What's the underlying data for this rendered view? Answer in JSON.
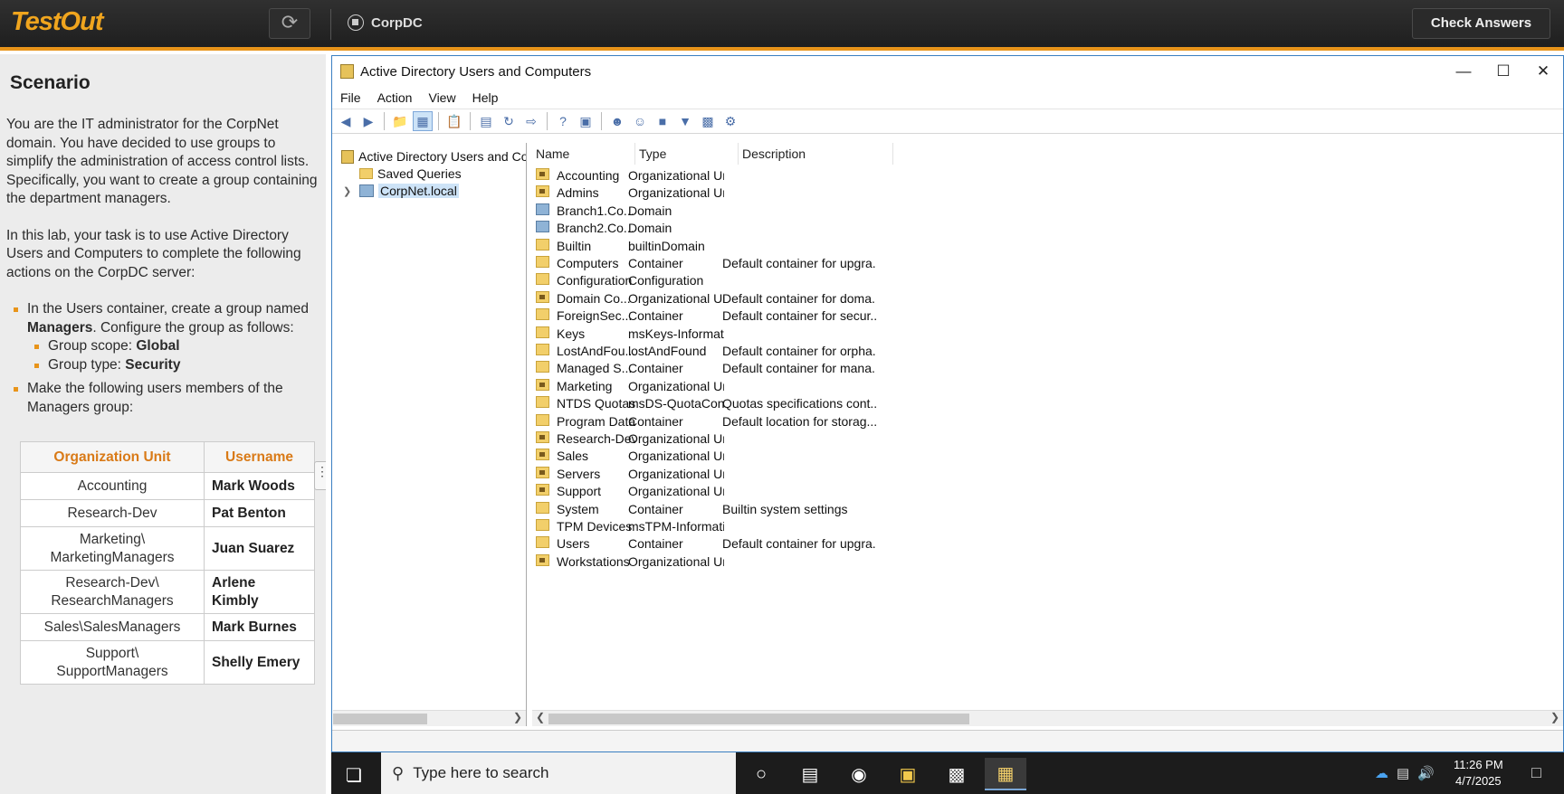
{
  "topbar": {
    "logo": "TestOut",
    "server": "CorpDC",
    "check_answers": "Check Answers"
  },
  "scenario": {
    "title": "Scenario",
    "intro": "You are the IT administrator for the CorpNet domain. You have decided to use groups to simplify the administration of access control lists. Specifically, you want to create a group containing the department managers.",
    "task_intro": "In this lab, your task is to use Active Directory Users and Computers to complete the following actions on the CorpDC server:",
    "task1_pre": "In the Users container, create a group named ",
    "task1_name": "Managers",
    "task1_post": ". Configure the group as follows:",
    "scope_label": "Group scope: ",
    "scope_value": "Global",
    "type_label": "Group type: ",
    "type_value": "Security",
    "task2": "Make the following users members of the Managers group:",
    "table_headers": [
      "Organization Unit",
      "Username"
    ],
    "table_rows": [
      {
        "ou": "Accounting",
        "user": "Mark Woods"
      },
      {
        "ou": "Research-Dev",
        "user": "Pat Benton"
      },
      {
        "ou": "Marketing\\\nMarketingManagers",
        "user": "Juan Suarez"
      },
      {
        "ou": "Research-Dev\\\nResearchManagers",
        "user": "Arlene\nKimbly"
      },
      {
        "ou": "Sales\\SalesManagers",
        "user": "Mark Burnes"
      },
      {
        "ou": "Support\\\nSupportManagers",
        "user": "Shelly Emery"
      }
    ]
  },
  "window": {
    "title": "Active Directory Users and Computers",
    "menu": [
      "File",
      "Action",
      "View",
      "Help"
    ],
    "tree": {
      "root": "Active Directory Users and Com",
      "saved_queries": "Saved Queries",
      "domain": "CorpNet.local"
    },
    "columns": [
      "Name",
      "Type",
      "Description"
    ],
    "rows": [
      {
        "name": "Accounting",
        "type": "Organizational Unit",
        "desc": "",
        "icon": "ou"
      },
      {
        "name": "Admins",
        "type": "Organizational Unit",
        "desc": "",
        "icon": "ou"
      },
      {
        "name": "Branch1.Co...",
        "type": "Domain",
        "desc": "",
        "icon": "domain"
      },
      {
        "name": "Branch2.Co...",
        "type": "Domain",
        "desc": "",
        "icon": "domain"
      },
      {
        "name": "Builtin",
        "type": "builtinDomain",
        "desc": "",
        "icon": "folder"
      },
      {
        "name": "Computers",
        "type": "Container",
        "desc": "Default container for upgra...",
        "icon": "folder"
      },
      {
        "name": "Configuration",
        "type": "Configuration",
        "desc": "",
        "icon": "folder"
      },
      {
        "name": "Domain Co...",
        "type": "Organizational Unit",
        "desc": "Default container for doma...",
        "icon": "ou"
      },
      {
        "name": "ForeignSec...",
        "type": "Container",
        "desc": "Default container for secur...",
        "icon": "folder"
      },
      {
        "name": "Keys",
        "type": "msKeys-Informat...",
        "desc": "",
        "icon": "folder"
      },
      {
        "name": "LostAndFou...",
        "type": "lostAndFound",
        "desc": "Default container for orpha...",
        "icon": "folder"
      },
      {
        "name": "Managed S...",
        "type": "Container",
        "desc": "Default container for mana...",
        "icon": "folder"
      },
      {
        "name": "Marketing",
        "type": "Organizational Unit",
        "desc": "",
        "icon": "ou"
      },
      {
        "name": "NTDS Quotas",
        "type": "msDS-QuotaCont...",
        "desc": "Quotas specifications cont...",
        "icon": "folder"
      },
      {
        "name": "Program Data",
        "type": "Container",
        "desc": "Default location for storag...",
        "icon": "folder"
      },
      {
        "name": "Research-Dev",
        "type": "Organizational Unit",
        "desc": "",
        "icon": "ou"
      },
      {
        "name": "Sales",
        "type": "Organizational Unit",
        "desc": "",
        "icon": "ou"
      },
      {
        "name": "Servers",
        "type": "Organizational Unit",
        "desc": "",
        "icon": "ou"
      },
      {
        "name": "Support",
        "type": "Organizational Unit",
        "desc": "",
        "icon": "ou"
      },
      {
        "name": "System",
        "type": "Container",
        "desc": "Builtin system settings",
        "icon": "folder"
      },
      {
        "name": "TPM Devices",
        "type": "msTPM-Informati...",
        "desc": "",
        "icon": "folder"
      },
      {
        "name": "Users",
        "type": "Container",
        "desc": "Default container for upgra...",
        "icon": "folder"
      },
      {
        "name": "Workstations",
        "type": "Organizational Unit",
        "desc": "",
        "icon": "ou"
      }
    ]
  },
  "taskbar": {
    "search_placeholder": "Type here to search",
    "time": "11:26 PM",
    "date": "4/7/2025"
  }
}
